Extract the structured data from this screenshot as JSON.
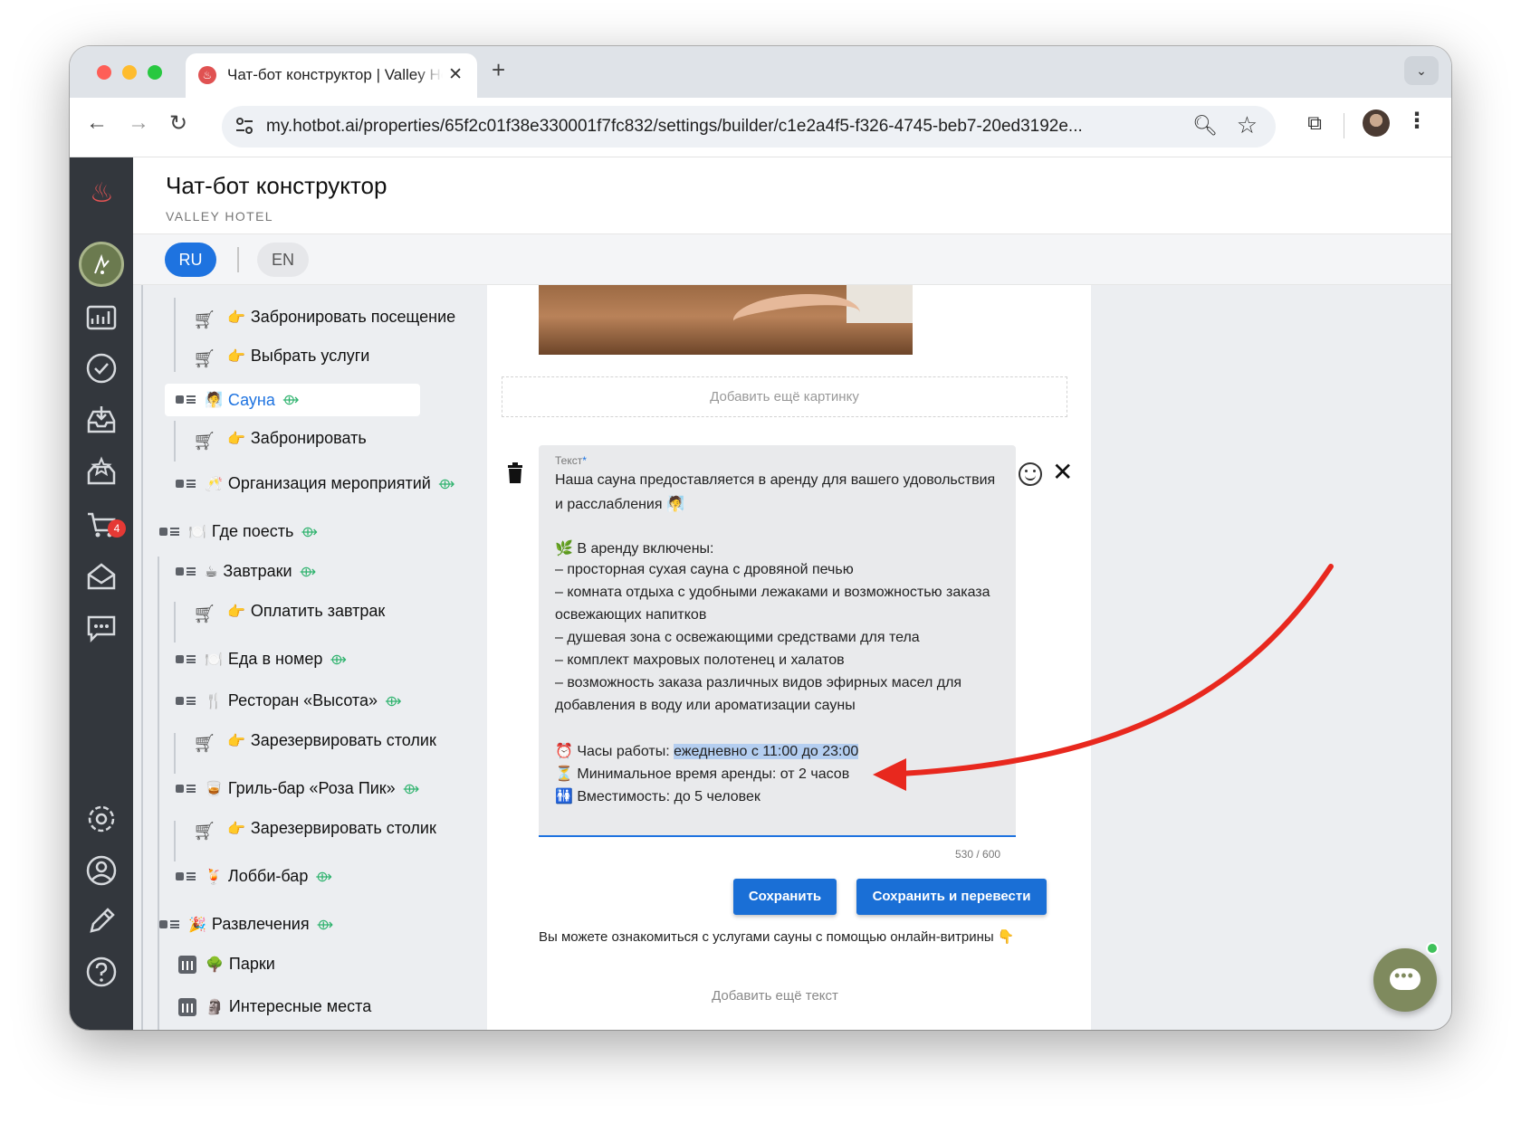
{
  "browser": {
    "tab_title": "Чат-бот конструктор | Valley Hotel",
    "url": "my.hotbot.ai/properties/65f2c01f38e330001f7fc832/settings/builder/c1e2a4f5-f326-4745-beb7-20ed3192e..."
  },
  "header": {
    "title": "Чат-бот конструктор",
    "subtitle": "VALLEY HOTEL"
  },
  "sidebar": {
    "cart_badge": "4",
    "icons": [
      "fire-logo-icon",
      "concierge-icon",
      "analytics-icon",
      "tasks-icon",
      "inbox-icon",
      "reviews-icon",
      "cart-icon",
      "mail-icon",
      "chat-icon",
      "settings-icon",
      "profile-icon",
      "edit-icon",
      "help-icon"
    ]
  },
  "languages": {
    "active": "RU",
    "other": "EN"
  },
  "tree": {
    "items": [
      {
        "icon": "cart",
        "emoji": "👉",
        "label": "Забронировать посещение"
      },
      {
        "icon": "cart",
        "emoji": "👉",
        "label": "Выбрать услуги"
      },
      {
        "icon": "card",
        "emoji": "🧖",
        "label": "Сауна",
        "active": true
      },
      {
        "icon": "cart",
        "emoji": "👉",
        "label": "Забронировать"
      },
      {
        "icon": "card",
        "emoji": "🥂",
        "label": "Организация мероприятий"
      },
      {
        "icon": "card",
        "emoji": "🍽️",
        "label": "Где поесть"
      },
      {
        "icon": "card",
        "emoji": "☕",
        "label": "Завтраки"
      },
      {
        "icon": "cart",
        "emoji": "👉",
        "label": "Оплатить завтрак"
      },
      {
        "icon": "card",
        "emoji": "🍽️",
        "label": "Еда в номер"
      },
      {
        "icon": "card",
        "emoji": "🍴",
        "label": "Ресторан «Высота»"
      },
      {
        "icon": "cart",
        "emoji": "👉",
        "label": "Зарезервировать столик"
      },
      {
        "icon": "card",
        "emoji": "🥃",
        "label": "Гриль-бар «Роза Пик»"
      },
      {
        "icon": "cart",
        "emoji": "👉",
        "label": "Зарезервировать столик"
      },
      {
        "icon": "card",
        "emoji": "🍹",
        "label": "Лобби-бар"
      },
      {
        "icon": "card",
        "emoji": "🎉",
        "label": "Развлечения"
      },
      {
        "icon": "chart",
        "emoji": "🌳",
        "label": "Парки"
      },
      {
        "icon": "chart",
        "emoji": "🗿",
        "label": "Интересные места"
      }
    ]
  },
  "editor": {
    "add_image": "Добавить ещё картинку",
    "text_label": "Текст",
    "required_mark": "*",
    "lines": [
      "Наша сауна предоставляется в аренду для вашего удовольствия",
      "и расслабления 🧖",
      "",
      "🌿 В аренду включены:",
      "– просторная сухая сауна с дровяной печью",
      "– комната отдыха с удобными лежаками и возможностью заказа",
      "освежающих напитков",
      "– душевая зона с освежающими средствами для тела",
      "– комплект махровых полотенец и халатов",
      "– возможность заказа различных видов эфирных масел для",
      "добавления в воду или ароматизации сауны",
      "",
      "⏰ Часы работы: ",
      "⏳ Минимальное время аренды: от 2 часов",
      "🚻 Вместимость: до 5 человек"
    ],
    "highlighted": "ежедневно с 11:00 до 23:00",
    "counter": "530 / 600",
    "save": "Сохранить",
    "save_translate": "Сохранить и перевести",
    "note": "Вы можете ознакомиться с услугами сауны с помощью онлайн-витрины 👇",
    "add_text": "Добавить ещё текст"
  },
  "colors": {
    "accent": "#1e73e0",
    "sidebar": "#33373d",
    "annotation_arrow": "#e8281e",
    "chat_bubble": "#7f8a5e"
  }
}
